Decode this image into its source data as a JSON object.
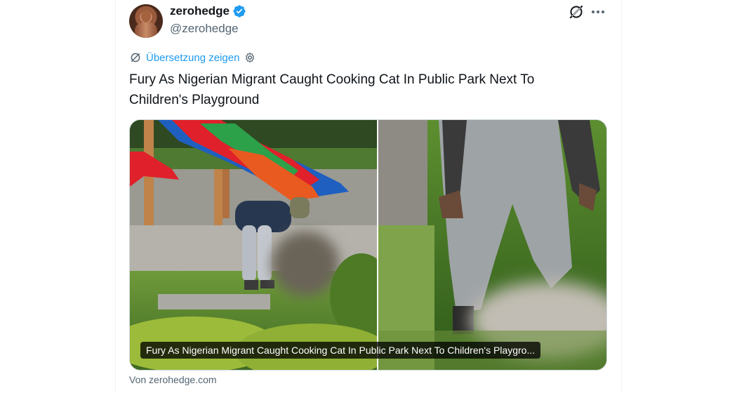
{
  "author": {
    "name": "zerohedge",
    "handle": "@zerohedge",
    "verified": true
  },
  "translate": {
    "label": "Übersetzung zeigen"
  },
  "tweet": {
    "text": "Fury As Nigerian Migrant Caught Cooking Cat In Public Park Next To Children's Playground"
  },
  "link_card": {
    "caption": "Fury As Nigerian Migrant Caught Cooking Cat In Public Park Next To Children's Playgro...",
    "source": "Von zerohedge.com"
  },
  "icons": {
    "grok": "grok-icon",
    "more": "more-icon",
    "verified": "verified-badge-icon",
    "translate": "translate-icon",
    "settings": "gear-icon"
  },
  "colors": {
    "accent": "#1d9bf0",
    "text": "#0f1419",
    "secondary": "#536471"
  }
}
